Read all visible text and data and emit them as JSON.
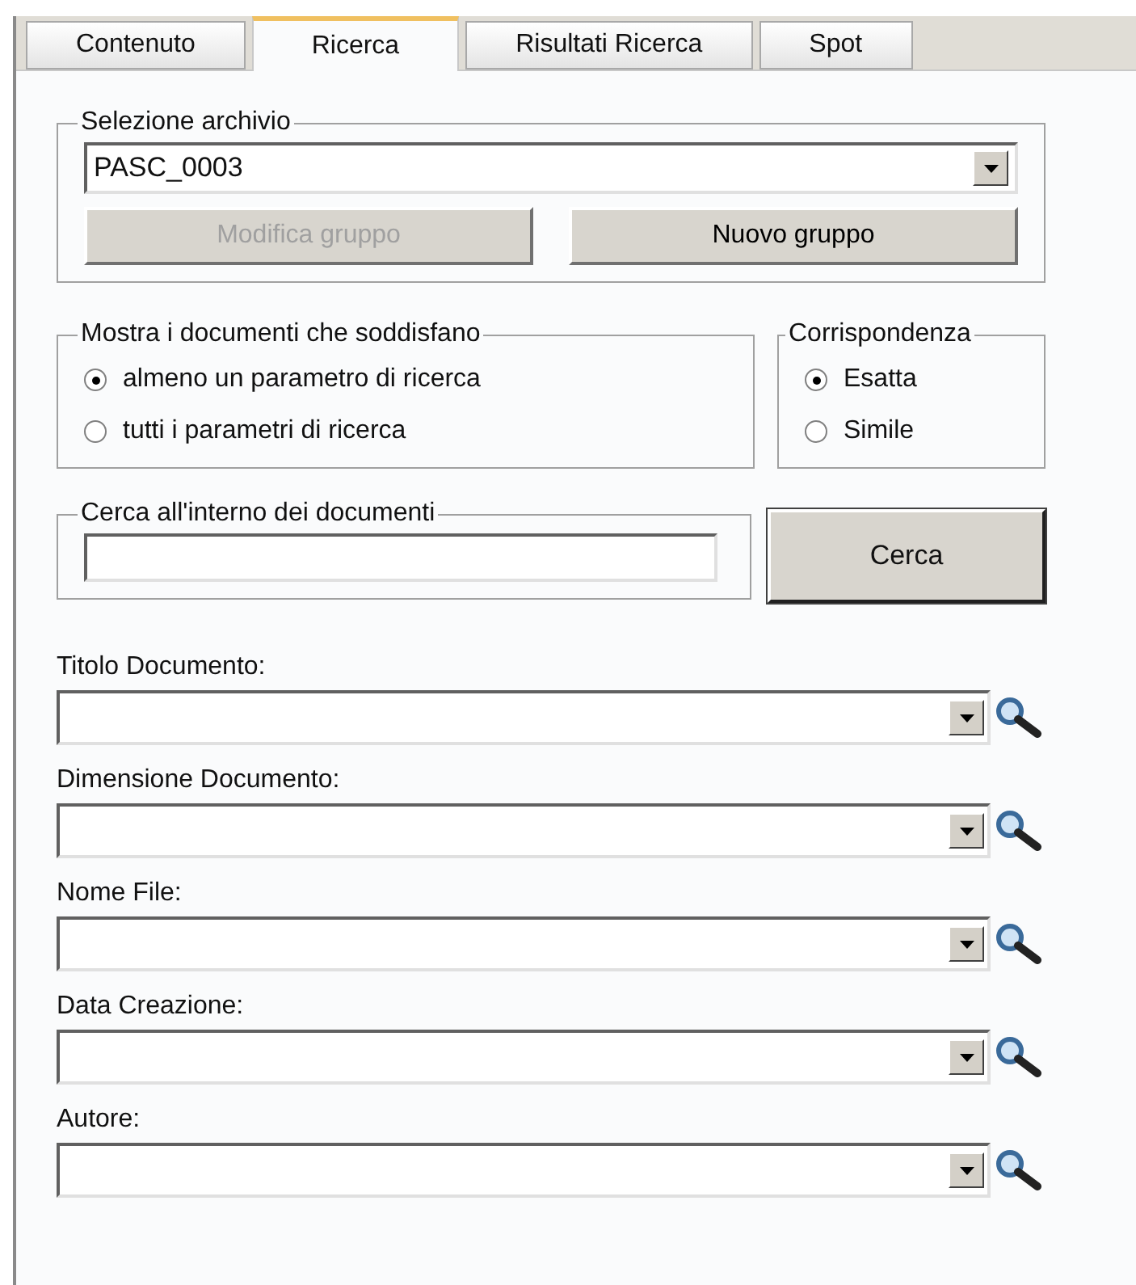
{
  "tabs": [
    {
      "label": "Contenuto",
      "selected": false
    },
    {
      "label": "Ricerca",
      "selected": true
    },
    {
      "label": "Risultati Ricerca",
      "selected": false
    },
    {
      "label": "Spot",
      "selected": false
    }
  ],
  "archive_group": {
    "legend": "Selezione archivio",
    "value": "PASC_0003",
    "buttons": [
      {
        "label": "Modifica gruppo",
        "disabled": true
      },
      {
        "label": "Nuovo gruppo",
        "disabled": false
      }
    ]
  },
  "show_documents": {
    "legend": "Mostra i documenti che soddisfano",
    "options": [
      {
        "label": "almeno un parametro di ricerca",
        "selected": true
      },
      {
        "label": "tutti i parametri di ricerca",
        "selected": false
      }
    ]
  },
  "match": {
    "legend": "Corrispondenza",
    "options": [
      {
        "label": "Esatta",
        "selected": true
      },
      {
        "label": "Simile",
        "selected": false
      }
    ]
  },
  "full_text": {
    "legend": "Cerca all'interno dei documenti"
  },
  "search_button": "Cerca",
  "fields": [
    {
      "label": "Titolo Documento:"
    },
    {
      "label": "Dimensione Documento:"
    },
    {
      "label": "Nome File:"
    },
    {
      "label": "Data Creazione:"
    },
    {
      "label": "Autore:"
    }
  ]
}
